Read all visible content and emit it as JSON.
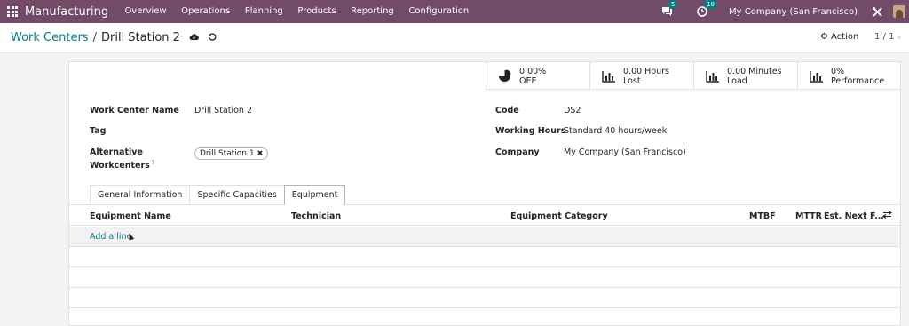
{
  "navbar": {
    "app_name": "Manufacturing",
    "menu": [
      "Overview",
      "Operations",
      "Planning",
      "Products",
      "Reporting",
      "Configuration"
    ],
    "messages_badge": "5",
    "activities_badge": "10",
    "company": "My Company (San Francisco)",
    "colors": {
      "background": "#714B67"
    }
  },
  "control_panel": {
    "breadcrumb_parent": "Work Centers",
    "breadcrumb_separator": "/",
    "breadcrumb_current": "Drill Station 2",
    "action_label": "Action",
    "pager": "1 / 1"
  },
  "stat_buttons": [
    {
      "value": "0.00%",
      "label": "OEE",
      "icon": "pie-chart-icon"
    },
    {
      "value": "0.00 Hours",
      "label": "Lost",
      "icon": "bar-chart-icon"
    },
    {
      "value": "0.00 Minutes",
      "label": "Load",
      "icon": "bar-chart-icon"
    },
    {
      "value": "0%",
      "label": "Performance",
      "icon": "bar-chart-icon"
    }
  ],
  "form": {
    "work_center_name_label": "Work Center Name",
    "work_center_name": "Drill Station 2",
    "tag_label": "Tag",
    "alternative_label_line1": "Alternative",
    "alternative_label_line2": "Workcenters",
    "alternative_help": "?",
    "alternative_tag": "Drill Station 1",
    "code_label": "Code",
    "code": "DS2",
    "working_hours_label": "Working Hours",
    "working_hours": "Standard 40 hours/week",
    "company_label": "Company",
    "company": "My Company (San Francisco)"
  },
  "tabs": [
    "General Information",
    "Specific Capacities",
    "Equipment"
  ],
  "active_tab": "Equipment",
  "equipment_table": {
    "columns": [
      "Equipment Name",
      "Technician",
      "Equipment Category",
      "MTBF",
      "MTTR",
      "Est. Next F..."
    ],
    "add_line": "Add a line"
  },
  "accent_color": "#017e84"
}
